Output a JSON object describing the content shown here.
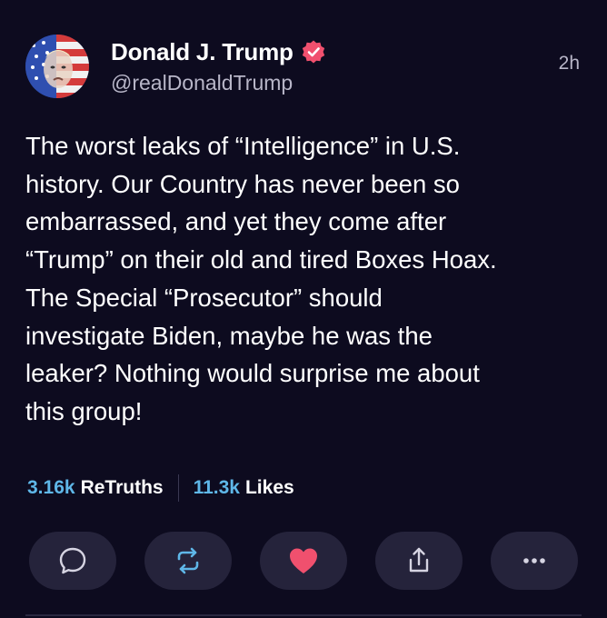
{
  "post": {
    "author_name": "Donald J. Trump",
    "handle": "@realDonaldTrump",
    "time_ago": "2h",
    "text": "The worst leaks of “Intelligence” in U.S.\nhistory. Our Country has never been so\nembarrassed, and yet they come after\n“Trump” on their old and tired Boxes Hoax.\nThe Special “Prosecutor” should\ninvestigate Biden, maybe he was the\nleaker? Nothing would surprise me about\nthis group!"
  },
  "stats": {
    "retruths_count": "3.16k",
    "retruths_label": "ReTruths",
    "likes_count": "11.3k",
    "likes_label": "Likes"
  },
  "actions": [
    {
      "icon": "reply-icon"
    },
    {
      "icon": "retruth-icon"
    },
    {
      "icon": "like-heart-icon"
    },
    {
      "icon": "share-icon"
    },
    {
      "icon": "more-icon"
    }
  ],
  "colors": {
    "background": "#0d0b1f",
    "accent_blue": "#5fb7e8",
    "heart": "#f0506e",
    "verified": "#f0506e"
  }
}
